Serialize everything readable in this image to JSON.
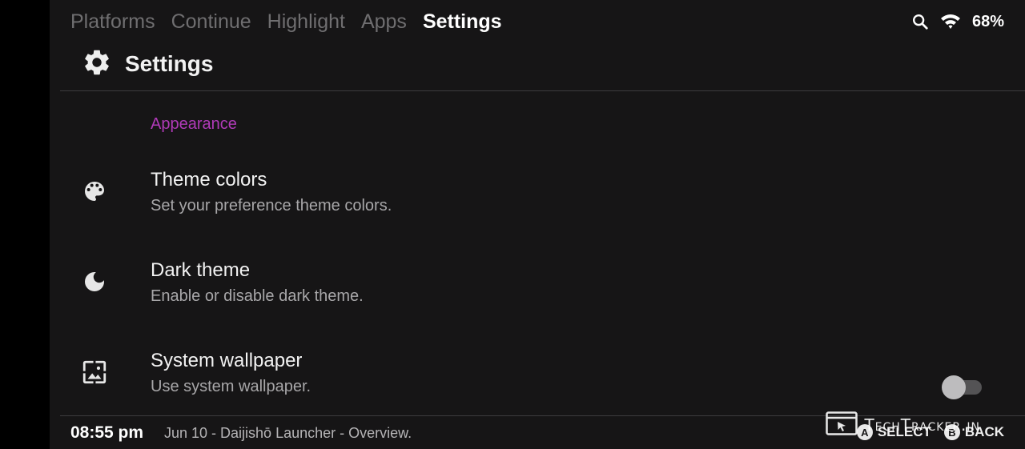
{
  "tabs": [
    {
      "label": "Platforms"
    },
    {
      "label": "Continue"
    },
    {
      "label": "Highlight"
    },
    {
      "label": "Apps"
    },
    {
      "label": "Settings",
      "active": true
    }
  ],
  "status": {
    "battery": "68%",
    "icons": [
      "search-icon",
      "wifi-icon"
    ]
  },
  "header": {
    "title": "Settings",
    "icon": "gear-icon"
  },
  "section": {
    "label": "Appearance"
  },
  "items": [
    {
      "title": "Theme colors",
      "subtitle": "Set your preference theme colors.",
      "icon": "palette-icon"
    },
    {
      "title": "Dark theme",
      "subtitle": "Enable or disable dark theme.",
      "icon": "moon-icon"
    },
    {
      "title": "System wallpaper",
      "subtitle": "Use system wallpaper.",
      "icon": "wallpaper-icon",
      "toggle": "off"
    }
  ],
  "footer": {
    "clock": "08:55 pm",
    "ticker": "Jun 10 - Daijishō Launcher - Overview.",
    "hints": [
      {
        "button": "A",
        "label": "SELECT"
      },
      {
        "button": "B",
        "label": "BACK"
      }
    ]
  },
  "watermark": {
    "text": "TechTracker.in"
  },
  "colors": {
    "background": "#161516",
    "accent": "#b03ab8",
    "inactive_tab": "#6f6e70"
  }
}
